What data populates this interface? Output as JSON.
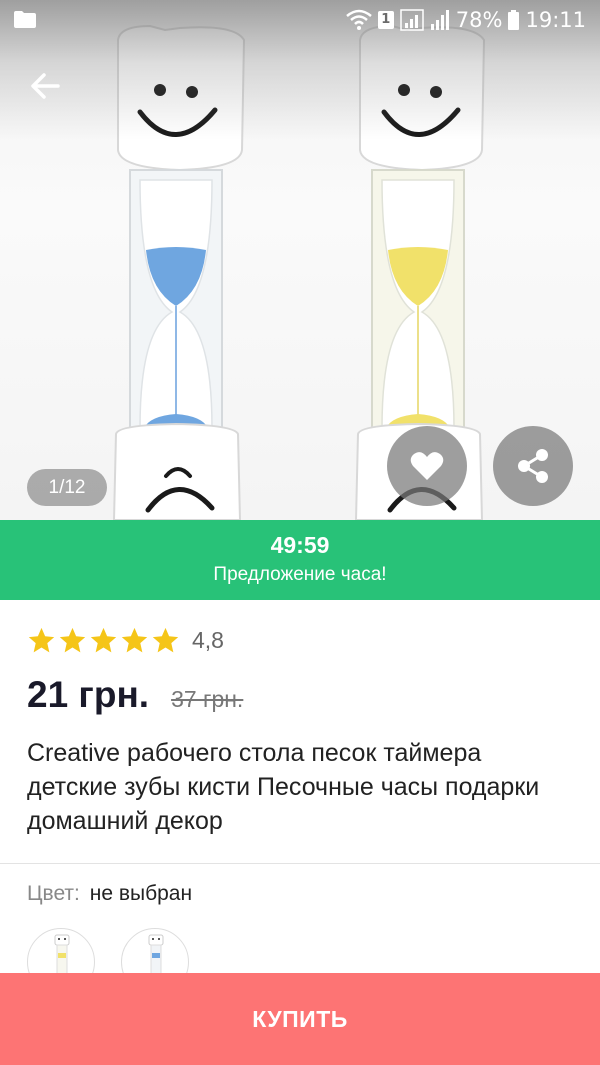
{
  "status_bar": {
    "battery": "78%",
    "sim_slot": "1",
    "time": "19:11"
  },
  "gallery": {
    "counter": "1/12"
  },
  "offer": {
    "timer": "49:59",
    "label": "Предложение часа!"
  },
  "product": {
    "rating": {
      "value_text": "4,8",
      "stars": 5,
      "star_color": "#f5c518"
    },
    "price": "21 грн.",
    "old_price": "37 грн.",
    "title": "Creative рабочего стола песок таймера детские зубы кисти Песочные часы подарки домашний декор"
  },
  "color": {
    "label": "Цвет:",
    "value": "не выбран",
    "swatches": [
      {
        "name": "yellow",
        "color": "#f1e16a"
      },
      {
        "name": "blue",
        "color": "#6fa6e0"
      }
    ]
  },
  "buy": {
    "label": "КУПИТЬ",
    "color": "#fd7474"
  },
  "colors": {
    "offer_green": "#28c278",
    "buy_red": "#fd7474"
  },
  "icons": [
    "folder-icon",
    "wifi-icon",
    "signal-icon",
    "battery-icon",
    "back-arrow-icon",
    "heart-icon",
    "share-icon",
    "star-icon"
  ]
}
